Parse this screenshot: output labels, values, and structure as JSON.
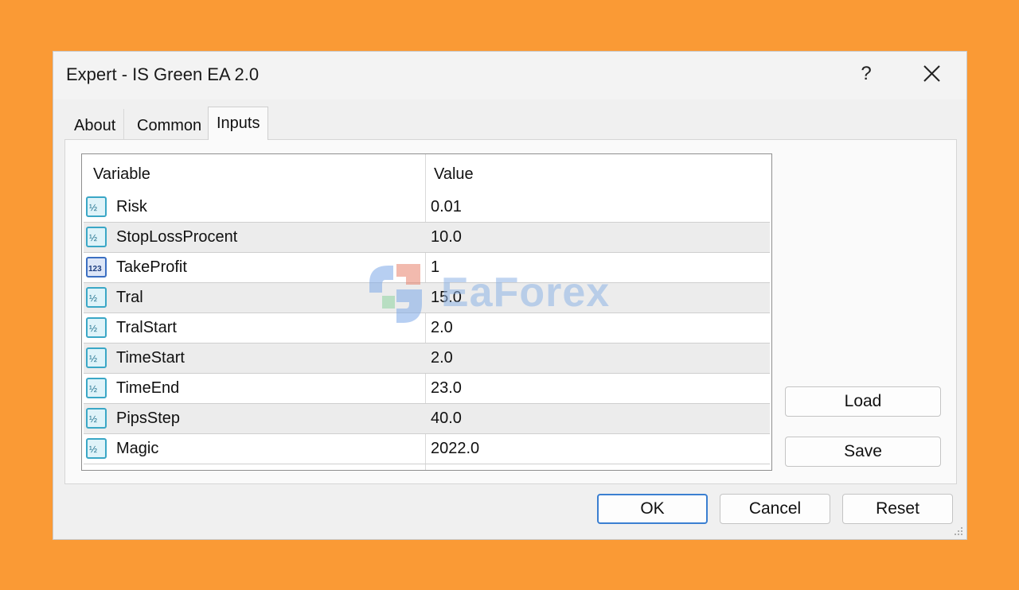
{
  "window": {
    "title": "Expert - IS Green EA 2.0",
    "help_label": "?"
  },
  "tabs": [
    {
      "label": "About"
    },
    {
      "label": "Common"
    },
    {
      "label": "Inputs",
      "active": true
    }
  ],
  "table": {
    "headers": {
      "variable": "Variable",
      "value": "Value"
    },
    "rows": [
      {
        "name": "Risk",
        "value": "0.01",
        "icon": "double-icon"
      },
      {
        "name": "StopLossProcent",
        "value": "10.0",
        "icon": "double-icon"
      },
      {
        "name": "TakeProfit",
        "value": "1",
        "icon": "integer-icon"
      },
      {
        "name": "Tral",
        "value": "15.0",
        "icon": "double-icon"
      },
      {
        "name": "TralStart",
        "value": "2.0",
        "icon": "double-icon"
      },
      {
        "name": "TimeStart",
        "value": "2.0",
        "icon": "double-icon"
      },
      {
        "name": "TimeEnd",
        "value": "23.0",
        "icon": "double-icon"
      },
      {
        "name": "PipsStep",
        "value": "40.0",
        "icon": "double-icon"
      },
      {
        "name": "Magic",
        "value": "2022.0",
        "icon": "double-icon"
      }
    ]
  },
  "side_buttons": {
    "load": "Load",
    "save": "Save"
  },
  "footer_buttons": {
    "ok": "OK",
    "cancel": "Cancel",
    "reset": "Reset"
  },
  "watermark": {
    "text": "EaForex"
  },
  "colors": {
    "background": "#fa9a35",
    "dialog": "#f0f0f0",
    "ok_border": "#3b7fd1"
  }
}
